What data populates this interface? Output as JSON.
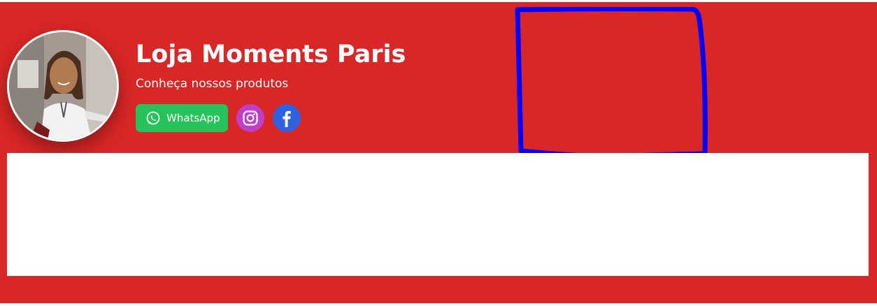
{
  "header": {
    "store_name": "Loja Moments Paris",
    "tagline": "Conheça nossos produtos"
  },
  "social": {
    "whatsapp_label": "WhatsApp",
    "whatsapp_icon": "whatsapp-icon",
    "instagram_icon": "instagram-icon",
    "facebook_icon": "facebook-icon"
  },
  "colors": {
    "banner": "#d92626",
    "whatsapp": "#25c35a",
    "instagram": "#c13fc7",
    "facebook": "#2f62e0",
    "annotation": "#0000ff"
  }
}
